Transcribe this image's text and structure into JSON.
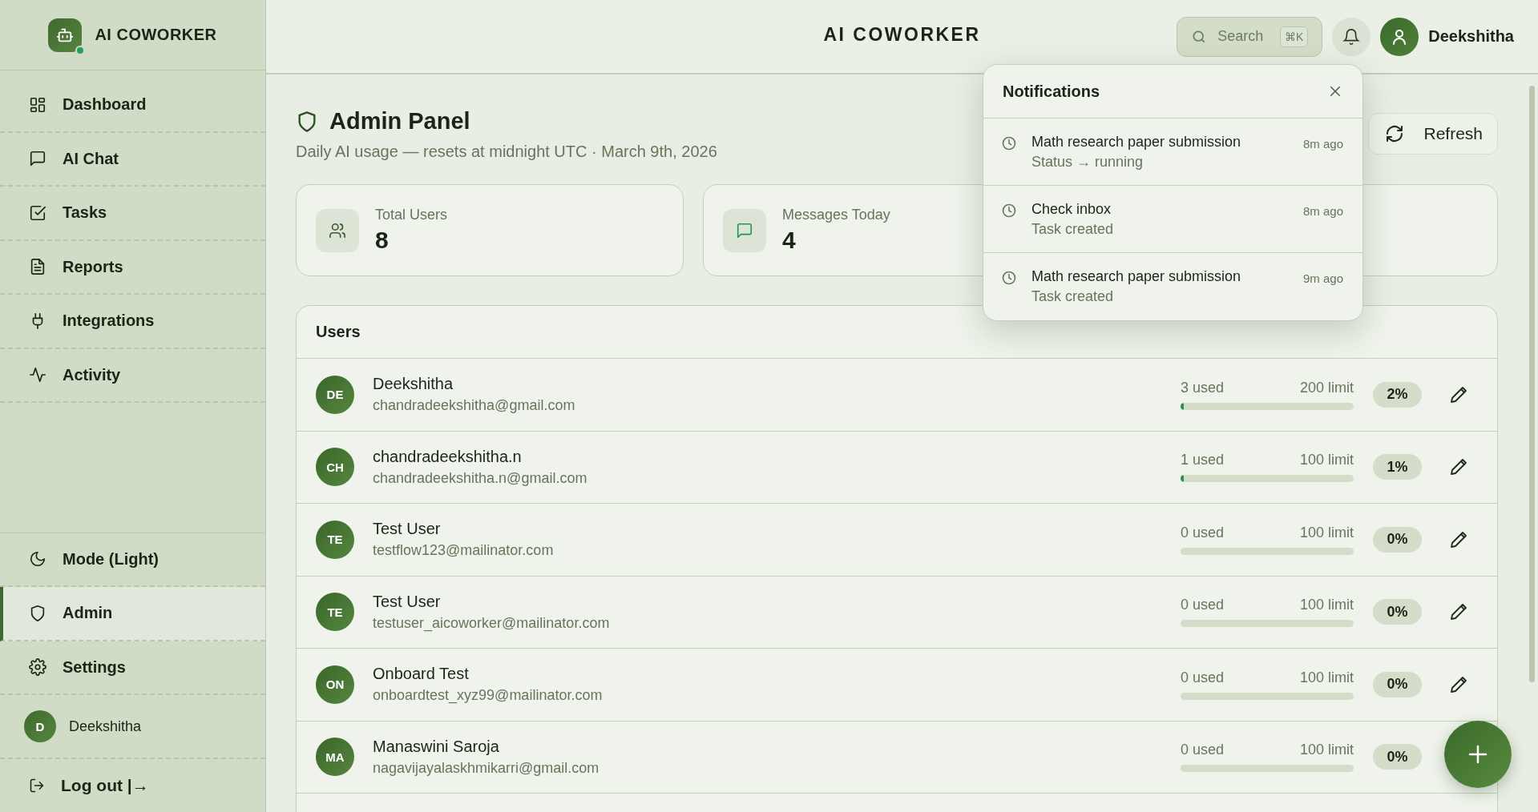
{
  "sidebar": {
    "brand": "AI COWORKER",
    "items": [
      {
        "label": "Dashboard",
        "selected": false
      },
      {
        "label": "AI Chat",
        "selected": false
      },
      {
        "label": "Tasks",
        "selected": false
      },
      {
        "label": "Reports",
        "selected": false
      },
      {
        "label": "Integrations",
        "selected": false
      },
      {
        "label": "Activity",
        "selected": false
      }
    ],
    "bottom_items": [
      {
        "label": "Mode (Light)",
        "selected": false
      },
      {
        "label": "Admin",
        "selected": true
      },
      {
        "label": "Settings",
        "selected": false
      }
    ],
    "user": {
      "initial": "D",
      "name": "Deekshitha"
    },
    "logout": "Log out |→"
  },
  "header": {
    "title": "AI COWORKER",
    "search": {
      "placeholder": "Search",
      "shortcut": "⌘K"
    },
    "user_name": "Deekshitha"
  },
  "page": {
    "title": "Admin Panel",
    "subtitle": "Daily AI usage — resets at midnight UTC · March 9th, 2026",
    "refresh": "Refresh"
  },
  "stats": [
    {
      "label": "Total Users",
      "value": "8"
    },
    {
      "label": "Messages Today",
      "value": "4"
    }
  ],
  "users": {
    "title": "Users",
    "rows": [
      {
        "initials": "DE",
        "name": "Deekshitha",
        "email": "chandradeekshitha@gmail.com",
        "used": "3 used",
        "limit": "200 limit",
        "level": 0.015,
        "percent": "2%"
      },
      {
        "initials": "CH",
        "name": "chandradeekshitha.n",
        "email": "chandradeekshitha.n@gmail.com",
        "used": "1 used",
        "limit": "100 limit",
        "level": 0.01,
        "percent": "1%"
      },
      {
        "initials": "TE",
        "name": "Test User",
        "email": "testflow123@mailinator.com",
        "used": "0 used",
        "limit": "100 limit",
        "level": 0,
        "percent": "0%"
      },
      {
        "initials": "TE",
        "name": "Test User",
        "email": "testuser_aicoworker@mailinator.com",
        "used": "0 used",
        "limit": "100 limit",
        "level": 0,
        "percent": "0%"
      },
      {
        "initials": "ON",
        "name": "Onboard Test",
        "email": "onboardtest_xyz99@mailinator.com",
        "used": "0 used",
        "limit": "100 limit",
        "level": 0,
        "percent": "0%"
      },
      {
        "initials": "MA",
        "name": "Manaswini Saroja",
        "email": "nagavijayalaskhmikarri@gmail.com",
        "used": "0 used",
        "limit": "100 limit",
        "level": 0,
        "percent": "0%"
      }
    ]
  },
  "notifications": {
    "title": "Notifications",
    "items": [
      {
        "title": "Math research paper submission",
        "detail": "Status → running",
        "time": "8m ago"
      },
      {
        "title": "Check inbox",
        "detail": "Task created",
        "time": "8m ago"
      },
      {
        "title": "Math research paper submission",
        "detail": "Task created",
        "time": "9m ago"
      }
    ]
  }
}
